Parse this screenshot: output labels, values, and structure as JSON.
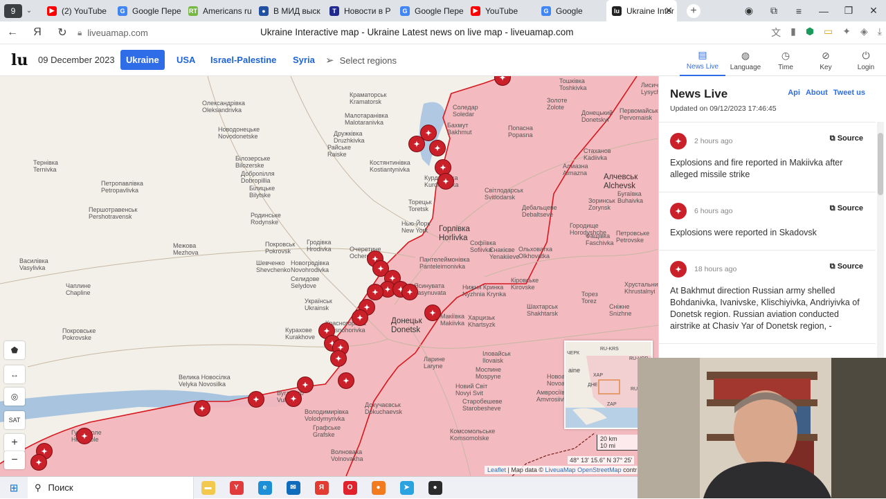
{
  "browser": {
    "tab_count": "9",
    "tabs": [
      {
        "title": "(2) YouTube",
        "color": "#ff0000",
        "glyph": "▶"
      },
      {
        "title": "Google Пере",
        "color": "#4285f4",
        "glyph": "G"
      },
      {
        "title": "Americans ru",
        "color": "#75b843",
        "glyph": "RT"
      },
      {
        "title": "В МИД выск",
        "color": "#2050a0",
        "glyph": "●"
      },
      {
        "title": "Новости в Р",
        "color": "#202a8e",
        "glyph": "T"
      },
      {
        "title": "Google Пере",
        "color": "#4285f4",
        "glyph": "G"
      },
      {
        "title": "YouTube",
        "color": "#ff0000",
        "glyph": "▶"
      },
      {
        "title": "Google",
        "color": "#4285f4",
        "glyph": "G"
      },
      {
        "title": "Ukraine Inter",
        "color": "#222222",
        "glyph": "lu"
      }
    ],
    "url": "liveuamap.com",
    "page_title": "Ukraine Interactive map - Ukraine Latest news on live map - liveuamap.com"
  },
  "site": {
    "logo": "lu",
    "date": "09 December 2023",
    "regions": [
      "Ukraine",
      "USA",
      "Israel-Palestine",
      "Syria"
    ],
    "active_region": "Ukraine",
    "select_regions": "Select regions",
    "nav": [
      {
        "label": "News Live",
        "icon": "news-icon",
        "glyph": "▤"
      },
      {
        "label": "Language",
        "icon": "language-icon",
        "glyph": "◍"
      },
      {
        "label": "Time",
        "icon": "clock-icon",
        "glyph": "◷"
      },
      {
        "label": "Key",
        "icon": "key-icon",
        "glyph": "⊘"
      },
      {
        "label": "Login",
        "icon": "login-icon",
        "glyph": "⏻"
      }
    ]
  },
  "map": {
    "controls": [
      "⬟",
      "↔",
      "◎",
      "SAT",
      "+",
      "−"
    ],
    "scale_km": "20 km",
    "scale_mi": "10 mi",
    "coords": "48° 13' 15.6\" N 37° 25'",
    "attribution": {
      "leaflet": "Leaflet",
      "sep": " | Map data © ",
      "liveuamap": "LiveuaMap",
      "osm": "OpenStreetMap",
      "rest": " contr"
    },
    "inset_labels": [
      "ЧЕРК",
      "ХАР",
      "ДНЕ",
      "ZAP",
      "RU-VOR",
      "RU-KRS",
      "RU-ROS",
      "aine"
    ],
    "cities": [
      {
        "name": "Краматорськ\nKramatorsk",
        "big": false
      },
      {
        "name": "Олександрівка\nOleksandrivka",
        "big": false
      },
      {
        "name": "Новодонецьке\nNovodonetske",
        "big": false
      },
      {
        "name": "Малотаранівка\nMalotaranivka",
        "big": false
      },
      {
        "name": "Дружківка\nDruzhkivka",
        "big": false
      },
      {
        "name": "Райське\nRaiske",
        "big": false
      },
      {
        "name": "Костянтинівка\nKostiantynivka",
        "big": false
      },
      {
        "name": "Білозерське\nBilozerske",
        "big": false
      },
      {
        "name": "Добропілля\nDobropillia",
        "big": false
      },
      {
        "name": "Білицьке\nBilytske",
        "big": false
      },
      {
        "name": "Петропавлівка\nPetropavlivka",
        "big": false
      },
      {
        "name": "Першотравенськ\nPershotravensk",
        "big": false
      },
      {
        "name": "Тернівка\nTernivka",
        "big": false
      },
      {
        "name": "Родинське\nRodynske",
        "big": false
      },
      {
        "name": "Покровськ\nPokrovsk",
        "big": false
      },
      {
        "name": "Межова\nMezhova",
        "big": false
      },
      {
        "name": "Шевченко\nShevchenko",
        "big": false
      },
      {
        "name": "Новогродівка\nNovohrodivka",
        "big": false
      },
      {
        "name": "Гродівка\nHrodivka",
        "big": false
      },
      {
        "name": "Очеретине\nOcheretyne",
        "big": false
      },
      {
        "name": "Селидове\nSelydove",
        "big": false
      },
      {
        "name": "Василівка\nVasylivka",
        "big": false
      },
      {
        "name": "Чаплине\nChapline",
        "big": false
      },
      {
        "name": "Українськ\nUkrainsk",
        "big": false
      },
      {
        "name": "Курахове\nKurakhove",
        "big": false
      },
      {
        "name": "Покровське\nPokrovske",
        "big": false
      },
      {
        "name": "Велика Новосілка\nVelyka Novosilka",
        "big": false
      },
      {
        "name": "Гуляйполе\nHuliaipole",
        "big": false
      },
      {
        "name": "Володимирівка\nVolodymyrivka",
        "big": false
      },
      {
        "name": "Графське\nGrafske",
        "big": false
      },
      {
        "name": "Волноваха\nVolnovakha",
        "big": false
      },
      {
        "name": "Докучаєвськ\nDokuchaevsk",
        "big": false
      },
      {
        "name": "Донецьк\nDonetsk",
        "big": true
      },
      {
        "name": "Горлівка\nHorlivka",
        "big": true
      },
      {
        "name": "Торецьк\nToretsk",
        "big": false
      },
      {
        "name": "Нью-Йорк\nNew York",
        "big": false
      },
      {
        "name": "Курдюмівка\nKurdiumivka",
        "big": false
      },
      {
        "name": "Бахмут\nBakhmut",
        "big": false
      },
      {
        "name": "Соледар\nSoledar",
        "big": false
      },
      {
        "name": "Попасна\nPopasna",
        "big": false
      },
      {
        "name": "Світлодарськ\nSvitlodarsk",
        "big": false
      },
      {
        "name": "Дебальцеве\nDebaltseve",
        "big": false
      },
      {
        "name": "Алчевськ\nAlchevsk",
        "big": true
      },
      {
        "name": "Стаханов\nKadiivka",
        "big": false
      },
      {
        "name": "Алмазна\nAlmazna",
        "big": false
      },
      {
        "name": "Зоринськ\nZorynsk",
        "big": false
      },
      {
        "name": "Бугаївка\nBuhaivka",
        "big": false
      },
      {
        "name": "Городище\nHorodyshche",
        "big": false
      },
      {
        "name": "Фащівка\nFaschivka",
        "big": false
      },
      {
        "name": "Петровське\nPetrovske",
        "big": false
      },
      {
        "name": "Ольховатка\nOlkhovatka",
        "big": false
      },
      {
        "name": "Софіївка\nSofiivka",
        "big": false
      },
      {
        "name": "Єнакієве\nYenakiieve",
        "big": false
      },
      {
        "name": "Пантелеймонівка\nPanteleimonivka",
        "big": false
      },
      {
        "name": "Нижня Кринка\nNyzhnia Krynka",
        "big": false
      },
      {
        "name": "Кіровське\nKirovske",
        "big": false
      },
      {
        "name": "Хрустальний\nKhrustalnyi",
        "big": false
      },
      {
        "name": "Харцизьк\nKhartsyzk",
        "big": false
      },
      {
        "name": "Шахтарськ\nShakhtarsk",
        "big": false
      },
      {
        "name": "Торез\nTorez",
        "big": false
      },
      {
        "name": "Сніжне\nSnizhne",
        "big": false
      },
      {
        "name": "Макіївка\nMakiivka",
        "big": false
      },
      {
        "name": "Ясинувата\nYasynuvata",
        "big": false
      },
      {
        "name": "Ларине\nLaryne",
        "big": false
      },
      {
        "name": "Іловайськ\nIlovaisk",
        "big": false
      },
      {
        "name": "Моспине\nMospyne",
        "big": false
      },
      {
        "name": "Новий Світ\nNovyi Svit",
        "big": false
      },
      {
        "name": "Старобешеве\nStarobesheve",
        "big": false
      },
      {
        "name": "Комсомольське\nKomsomolske",
        "big": false
      },
      {
        "name": "Амвросіївка\nAmvrosiivka",
        "big": false
      },
      {
        "name": "Новоамвросіївське\nNovoamvrosiivske",
        "big": false
      },
      {
        "name": "Красногорівка\nKrasnohorivka",
        "big": false
      },
      {
        "name": "Тошківка\nToshkivka",
        "big": false
      },
      {
        "name": "Золоте\nZolote",
        "big": false
      },
      {
        "name": "Первомайськ\nPervomaisk",
        "big": false
      },
      {
        "name": "Лисичанськ\nLysychansk",
        "big": false
      },
      {
        "name": "Донецький\nDonetskyi",
        "big": false
      },
      {
        "name": "Вугледар\nVuhledar",
        "big": false
      }
    ]
  },
  "news": {
    "title": "News Live",
    "links": [
      "Api",
      "About",
      "Tweet us"
    ],
    "updated": "Updated on 09/12/2023 17:46:45",
    "source_label": "Source",
    "items": [
      {
        "time": "2 hours ago",
        "text": "Explosions and fire reported in Makiivka after alleged missile strike",
        "icon": "explosion-icon"
      },
      {
        "time": "6 hours ago",
        "text": "Explosions were reported in Skadovsk",
        "icon": "explosion-icon"
      },
      {
        "time": "18 hours ago",
        "text": "At Bakhmut direction Russian army shelled Bohdanivka, Ivanivske, Klischiyivka, Andriyivka of Donetsk region. Russian aviation conducted airstrike at Chasiv Yar of Donetsk region, -",
        "icon": "artillery-icon"
      }
    ]
  },
  "taskbar": {
    "search_label": "Поиск",
    "apps": [
      {
        "name": "file-explorer",
        "color": "#f2c94c",
        "glyph": "▬"
      },
      {
        "name": "yandex-music",
        "color": "#e23b3b",
        "glyph": "Y"
      },
      {
        "name": "edge",
        "color": "#1d8fd6",
        "glyph": "e"
      },
      {
        "name": "mail",
        "color": "#0f6cbd",
        "glyph": "✉"
      },
      {
        "name": "yandex-browser",
        "color": "#e13b32",
        "glyph": "Я"
      },
      {
        "name": "opera",
        "color": "#e0222c",
        "glyph": "O"
      },
      {
        "name": "firefox",
        "color": "#f27b20",
        "glyph": "●"
      },
      {
        "name": "telegram",
        "color": "#2aa3e0",
        "glyph": "➤"
      },
      {
        "name": "obs",
        "color": "#2b2b2b",
        "glyph": "●"
      }
    ]
  },
  "colors": {
    "occupied": "#f2b6bd",
    "front_line": "#d6181f",
    "accent": "#2f6de8",
    "marker": "#c9202a"
  }
}
